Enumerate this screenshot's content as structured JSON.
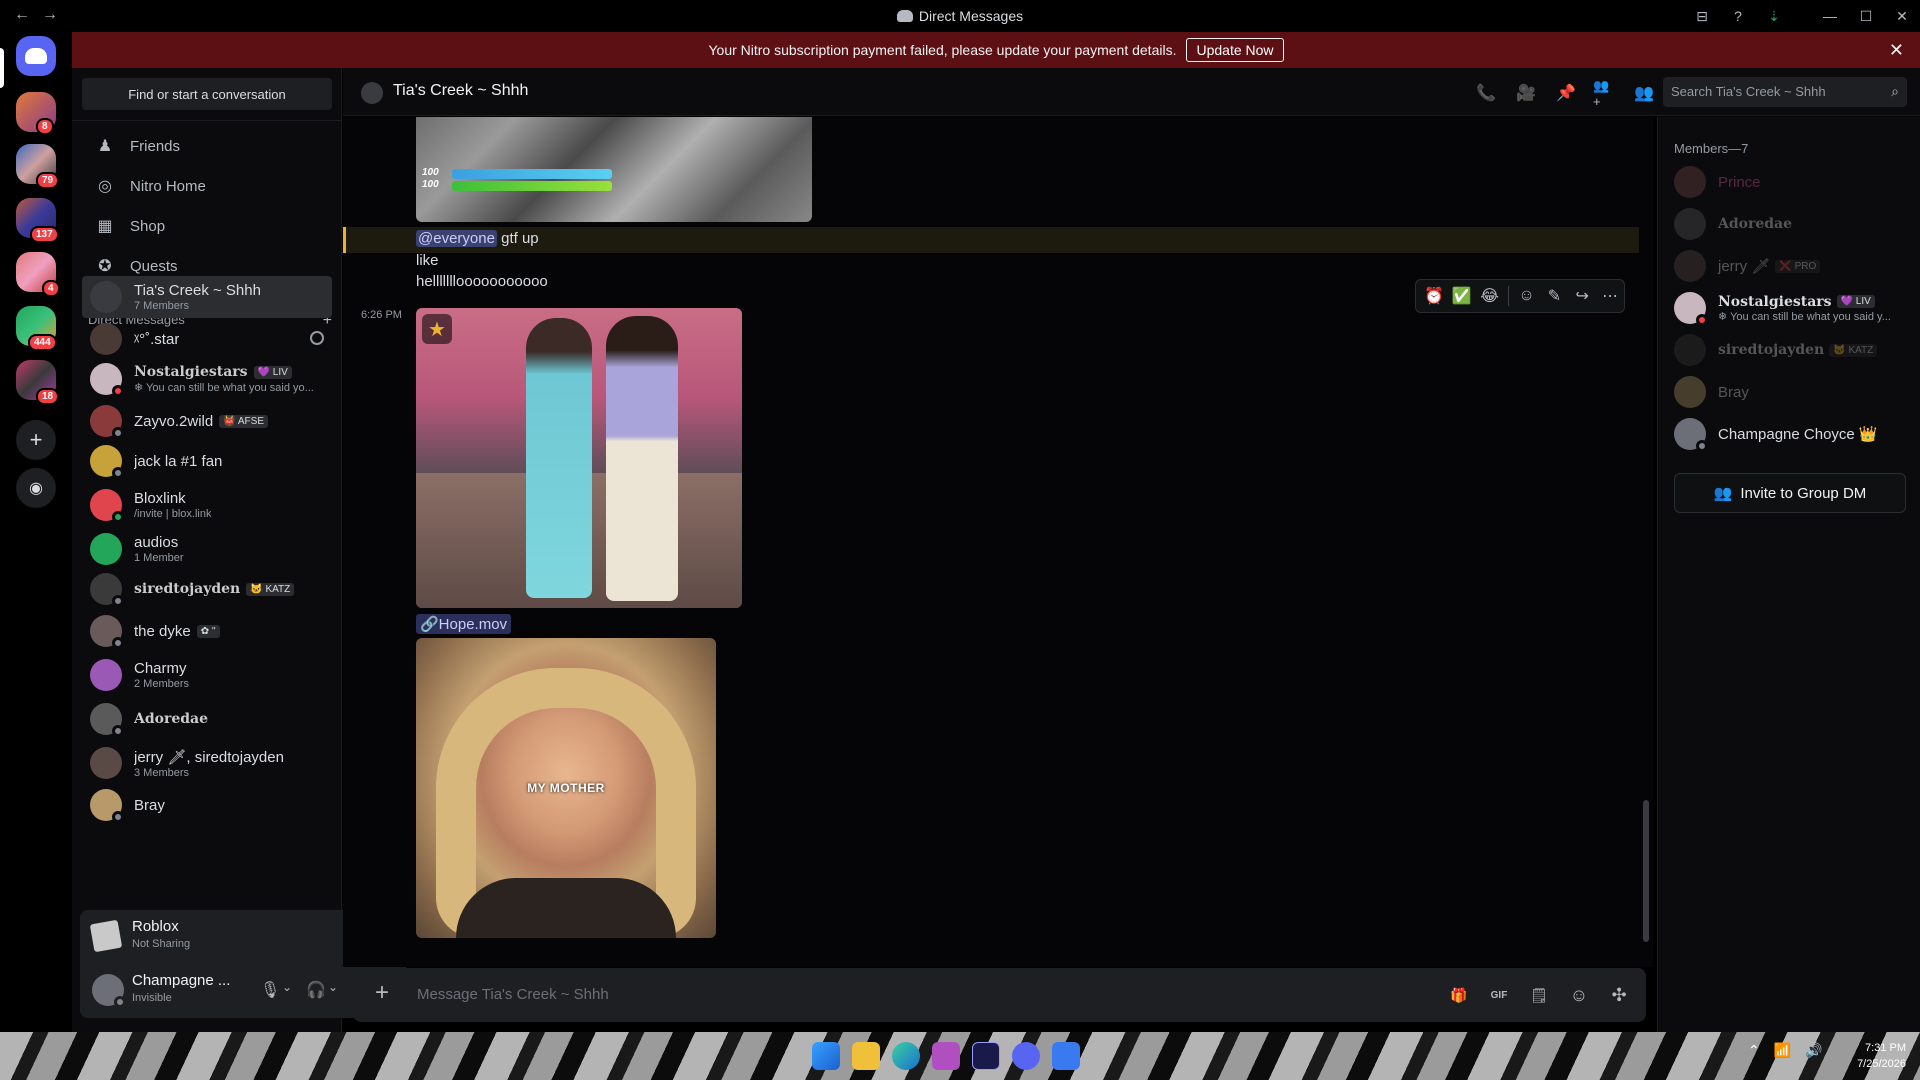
{
  "window": {
    "title": "Direct Messages",
    "back_icon": "←",
    "forward_icon": "→",
    "inbox_icon": "⊟",
    "help_icon": "?",
    "download_icon": "⇣",
    "minimize_icon": "—",
    "maximize_icon": "☐",
    "close_icon": "✕"
  },
  "rail": {
    "badges": [
      "8",
      "79",
      "137",
      "4",
      "444",
      "18"
    ]
  },
  "banner": {
    "text": "Your Nitro subscription payment failed, please update your payment details.",
    "button": "Update Now",
    "close": "✕"
  },
  "sidebar": {
    "search": "Find or start a conversation",
    "nav": [
      {
        "label": "Friends",
        "icon": "♟"
      },
      {
        "label": "Nitro Home",
        "icon": "◎"
      },
      {
        "label": "Shop",
        "icon": "▦"
      },
      {
        "label": "Quests",
        "icon": "✪"
      }
    ],
    "dm_header": "Direct Messages",
    "dm_add": "+",
    "dms": [
      {
        "name": "Tia's Creek ~ Shhh",
        "sub": "7 Members",
        "color": "#3a3b40"
      },
      {
        "name": "ᵡ°˚.star",
        "sub": "",
        "color": "#4a3a35"
      },
      {
        "name": "Nostalgiestars",
        "tag": "💜 LIV",
        "sub": "❄ You can still be what you said yo...",
        "color": "#c9b7c0",
        "status": "#f23f43"
      },
      {
        "name": "Zayvo.2wild",
        "tag": "👹 AFSE",
        "sub": "",
        "color": "#8a3a3a",
        "status": "#80848e"
      },
      {
        "name": "jack la #1 fan",
        "sub": "",
        "color": "#c7a23a",
        "status": "#80848e"
      },
      {
        "name": "Bloxlink",
        "sub": "/invite | blox.link",
        "color": "#e0454e",
        "status": "#23a55a"
      },
      {
        "name": "audios",
        "sub": "1 Member",
        "color": "#23a55a"
      },
      {
        "name": "siredtojayden",
        "tag": "🐱 KATZ",
        "sub": "",
        "color": "#3a3a3a",
        "status": "#80848e"
      },
      {
        "name": "the dyke",
        "tag": "✿ ''",
        "sub": "",
        "color": "#6a5a5a",
        "status": "#80848e"
      },
      {
        "name": "Charmy",
        "sub": "2 Members",
        "color": "#9b59b6"
      },
      {
        "name": "Adoredae",
        "sub": "",
        "color": "#5a5a5a",
        "status": "#80848e"
      },
      {
        "name": "jerry 🗡, siredtojayden",
        "sub": "3 Members",
        "color": "#5a4a45"
      },
      {
        "name": "Bray",
        "sub": "",
        "color": "#b89a6a",
        "status": "#80848e"
      }
    ]
  },
  "activity": {
    "game": "Roblox",
    "status": "Not Sharing"
  },
  "user": {
    "name": "Champagne ...",
    "status": "Invisible",
    "mic_icon": "🎙",
    "headset_icon": "🎧",
    "settings_icon": "⚙",
    "chevron": "⌄"
  },
  "chat": {
    "name": "Tia's Creek ~ Shhh",
    "search_placeholder": "Search Tia's Creek ~ Shhh",
    "header_icons": [
      "📞",
      "🎥",
      "📌",
      "👥+",
      "👥"
    ],
    "game_labels": [
      "100",
      "100"
    ],
    "messages": [
      {
        "mention": "@everyone",
        "text": " gtf up"
      },
      {
        "text": "like"
      },
      {
        "text": "helllllllooooooooooo"
      }
    ],
    "timestamp": "6:26 PM",
    "attachment_link": "🔗Hope.mov",
    "gif_caption": "MY MOTHER",
    "composer_placeholder": "Message Tia's Creek ~ Shhh",
    "composer_icons": [
      "🎁",
      "GIF",
      "🗒",
      "☺",
      "✣"
    ],
    "hover_actions": [
      "⏰",
      "✅",
      "😂",
      "☺",
      "✎",
      "↪",
      "⋯"
    ]
  },
  "members": {
    "header": "Members—7",
    "list": [
      {
        "name": "Prince",
        "dim": true,
        "color": "#7a4a4a",
        "text_color": "#e0609a"
      },
      {
        "name": "Adoredae",
        "dim": true,
        "bold": true,
        "color": "#5a5a5a"
      },
      {
        "name": "jerry 🗡",
        "tag": "❌ PRO",
        "dim": true,
        "color": "#5a4a45"
      },
      {
        "name": "Nostalgiestars",
        "tag": "💜 LIV",
        "bold": true,
        "sub": "❄ You can still be what you said y...",
        "color": "#c9b7c0",
        "status": "#f23f43"
      },
      {
        "name": "siredtojayden",
        "tag": "🐱 KATZ",
        "dim": true,
        "bold": true,
        "color": "#3a3a3a"
      },
      {
        "name": "Bray",
        "dim": true,
        "color": "#b89a6a"
      },
      {
        "name": "Champagne Choyce 👑",
        "color": "#6d6f78",
        "status": "#80848e"
      }
    ],
    "invite": "Invite to Group DM"
  },
  "taskbar": {
    "time": "7:31 PM",
    "date": "7/25/2026",
    "tray": [
      "⌃",
      "📶",
      "🔊"
    ]
  }
}
